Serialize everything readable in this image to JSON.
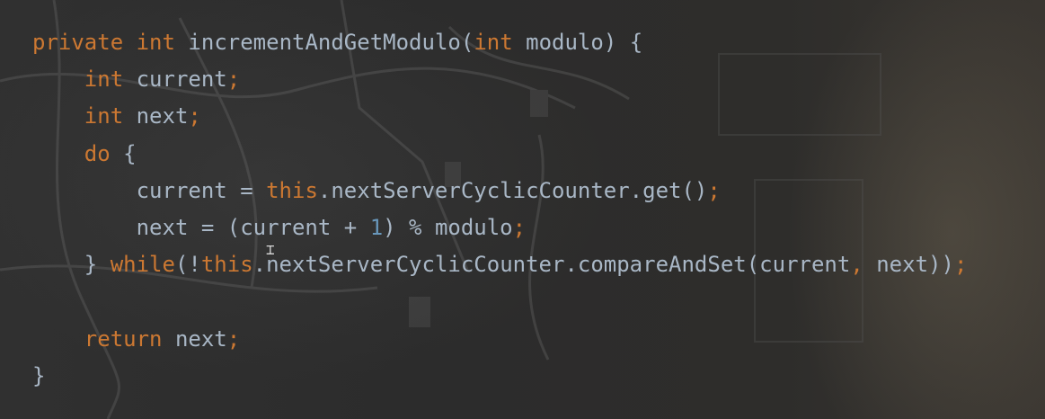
{
  "editor": {
    "language": "java",
    "colors": {
      "background": "#2b2b2b",
      "keyword": "#cc7832",
      "number": "#6897bb",
      "text": "#a9b7c6"
    },
    "lines": [
      [
        {
          "t": "kw",
          "v": "private"
        },
        {
          "t": "txt",
          "v": " "
        },
        {
          "t": "kw",
          "v": "int"
        },
        {
          "t": "txt",
          "v": " incrementAndGetModulo("
        },
        {
          "t": "kw",
          "v": "int"
        },
        {
          "t": "txt",
          "v": " modulo) {"
        }
      ],
      [
        {
          "t": "txt",
          "v": "    "
        },
        {
          "t": "kw",
          "v": "int"
        },
        {
          "t": "txt",
          "v": " current"
        },
        {
          "t": "kw",
          "v": ";"
        }
      ],
      [
        {
          "t": "txt",
          "v": "    "
        },
        {
          "t": "kw",
          "v": "int"
        },
        {
          "t": "txt",
          "v": " next"
        },
        {
          "t": "kw",
          "v": ";"
        }
      ],
      [
        {
          "t": "txt",
          "v": "    "
        },
        {
          "t": "kw",
          "v": "do"
        },
        {
          "t": "txt",
          "v": " {"
        }
      ],
      [
        {
          "t": "txt",
          "v": "        current = "
        },
        {
          "t": "kw",
          "v": "this"
        },
        {
          "t": "txt",
          "v": ".nextServerCyclicCounter.get()"
        },
        {
          "t": "kw",
          "v": ";"
        }
      ],
      [
        {
          "t": "txt",
          "v": "        next = (current + "
        },
        {
          "t": "num",
          "v": "1"
        },
        {
          "t": "txt",
          "v": ") % modulo"
        },
        {
          "t": "kw",
          "v": ";"
        }
      ],
      [
        {
          "t": "txt",
          "v": "    } "
        },
        {
          "t": "kw",
          "v": "while"
        },
        {
          "t": "txt",
          "v": "(!"
        },
        {
          "t": "kw",
          "v": "this"
        },
        {
          "t": "txt",
          "v": ".nextServerCyclicCounter.compareAndSet(current"
        },
        {
          "t": "kw",
          "v": ","
        },
        {
          "t": "txt",
          "v": " next))"
        },
        {
          "t": "kw",
          "v": ";"
        }
      ],
      [
        {
          "t": "txt",
          "v": ""
        }
      ],
      [
        {
          "t": "txt",
          "v": "    "
        },
        {
          "t": "kw",
          "v": "return"
        },
        {
          "t": "txt",
          "v": " next"
        },
        {
          "t": "kw",
          "v": ";"
        }
      ],
      [
        {
          "t": "txt",
          "v": "}"
        }
      ]
    ],
    "cursor_icon": "text-cursor-icon"
  }
}
